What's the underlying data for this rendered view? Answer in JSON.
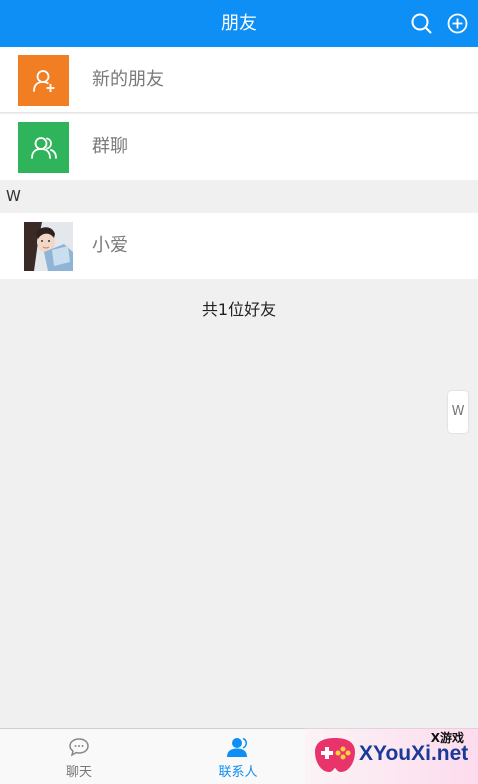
{
  "header": {
    "title": "朋友",
    "search_icon": "search-icon",
    "add_icon": "plus-circle-icon"
  },
  "list": {
    "new_friends_label": "新的朋友",
    "group_chat_label": "群聊",
    "section_letter": "W",
    "contacts": [
      {
        "name": "小爱"
      }
    ]
  },
  "friend_count_text": "共1位好友",
  "index_bar": {
    "letter": "W"
  },
  "tabbar": {
    "tabs": [
      {
        "label": "聊天",
        "icon": "chat-bubble-icon",
        "active": false
      },
      {
        "label": "联系人",
        "icon": "contacts-person-icon",
        "active": true
      }
    ]
  },
  "watermark": {
    "small": "X游戏",
    "text": "XYouXi.net"
  },
  "colors": {
    "accent": "#0d8ff5",
    "new_friends_avatar": "#f27e24",
    "group_avatar": "#2fb35b",
    "background": "#f0f0f0"
  }
}
